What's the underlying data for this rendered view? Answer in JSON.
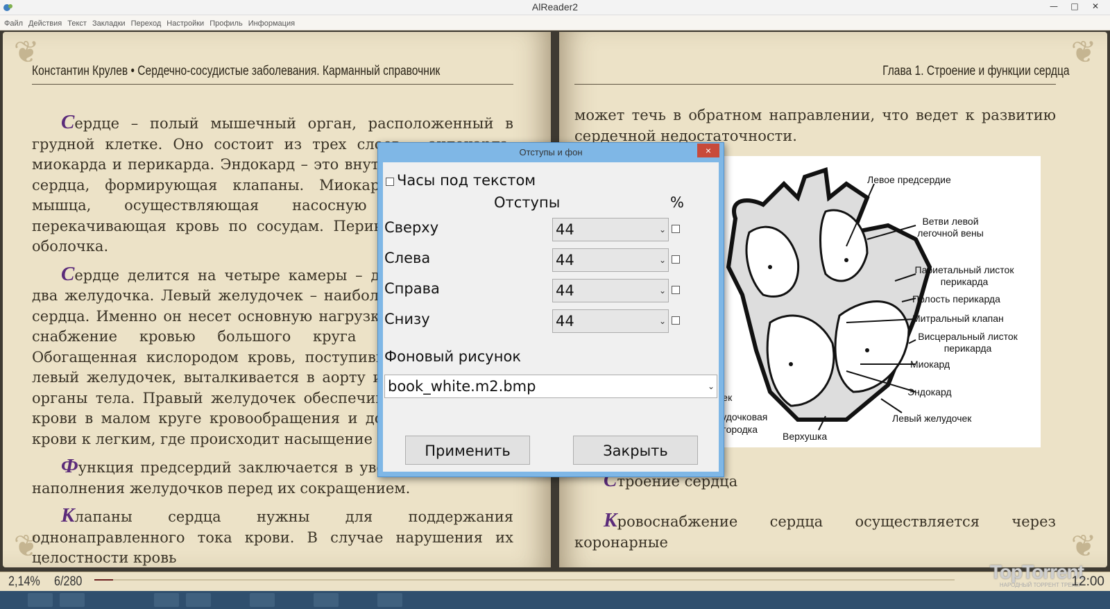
{
  "window": {
    "title": "AlReader2"
  },
  "menu": [
    "Файл",
    "Действия",
    "Текст",
    "Закладки",
    "Переход",
    "Настройки",
    "Профиль",
    "Информация"
  ],
  "left_page": {
    "running_head": "Константин Крулев • Сердечно-сосудистые заболевания. Карманный справочник",
    "paragraphs": [
      {
        "cap": "С",
        "text": "ердце – полый мышечный орган, расположенный в грудной клетке. Оно состоит из трех слоев – эндокарда, миокарда и перикарда. Эндокард – это внутренняя выстилка сердца, формирующая клапаны. Миокард – собственно мышца, осуществляющая насосную функцию и перекачивающая кровь по сосудам. Перикард – наружная оболочка."
      },
      {
        "cap": "С",
        "text": "ердце делится на четыре камеры – два предсердия и два желудочка. Левый желудочек – наиболее мощная часть сердца. Именно он несет основную нагрузку. Его функция – снабжение кровью большого круга кровообращения. Обогащенная кислородом кровь, поступившая из легких в левый желудочек, выталкивается в аорту и из нее – во все органы тела. Правый желудочек обеспечивает циркуляцию крови в малом круге кровообращения и доставку венозной крови к легким, где происходит насыщение ее кислородом."
      },
      {
        "cap": "Ф",
        "text": "ункция предсердий заключается в увеличении объема наполнения желудочков перед их сокращением."
      },
      {
        "cap": "К",
        "text": "лапаны сердца нужны для поддержания однонаправленного тока крови. В случае нарушения их целостности кровь"
      }
    ]
  },
  "right_page": {
    "running_head": "Глава 1. Строение и функции сердца",
    "top_text": "может течь в обратном направлении, что ведет к развитию сердечной недостаточности.",
    "figure_labels": {
      "l1": "Левое предсердие",
      "l2": "Ветви левой легочной вены",
      "l3": "Париетальный листок перикарда",
      "l4": "Полость перикарда",
      "l5": "Митральный клапан",
      "l6": "Висцеральный листок перикарда",
      "l7": "Миокард",
      "l8": "Эндокард",
      "l9": "Левый желудочек",
      "l10": "Верхушка",
      "l11": "чек",
      "l12": "лудочковая",
      "l13": "егородка"
    },
    "caption": {
      "cap": "С",
      "text": "троение сердца"
    },
    "last": {
      "cap": "К",
      "text": "ровоснабжение сердца осуществляется через коронарные"
    }
  },
  "status": {
    "percent": "2,14%",
    "pages": "6/280",
    "progress": 0.0214,
    "clock": "12:00",
    "watermark": "TopTorrent",
    "watermark_sub": "НАРОДНЫЙ ТОРРЕНТ ТРЕКЕР"
  },
  "dialog": {
    "title": "Отступы и фон",
    "close": "×",
    "clock_label": "Часы под текстом",
    "margins_header": "Отступы",
    "percent_header": "%",
    "rows": [
      {
        "label": "Сверху",
        "value": "44"
      },
      {
        "label": "Слева",
        "value": "44"
      },
      {
        "label": "Справа",
        "value": "44"
      },
      {
        "label": "Снизу",
        "value": "44"
      }
    ],
    "bg_label": "Фоновый рисунок",
    "bg_value": "book_white.m2.bmp",
    "apply": "Применить",
    "close_btn": "Закрыть"
  },
  "colors": {
    "page": "#ece2c7",
    "dropcap": "#5b2b7a",
    "dialog_frame": "#7fb7e6",
    "close_btn": "#c84a3a"
  }
}
